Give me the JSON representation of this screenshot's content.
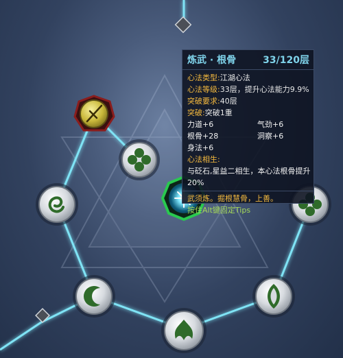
{
  "tooltip": {
    "title": "炼武 · 根骨",
    "level_text": "33/120层",
    "type_label": "心法类型:",
    "type_value": "江湖心法",
    "level_label": "心法等级:",
    "level_value": "33层，提升心法能力9.9%",
    "breakthrough_req_label": "突破要求:",
    "breakthrough_req_value": "40层",
    "breakthrough_label": "突破:",
    "breakthrough_value": "突破1重",
    "stats": [
      {
        "left": "力道+6",
        "right": "气劲+6"
      },
      {
        "left": "根骨+28",
        "right": "洞察+6"
      },
      {
        "left": "身法+6",
        "right": ""
      }
    ],
    "synergy_label": "心法相生:",
    "synergy_text_line1": "与砭石,星益二相生，本心法根骨提升",
    "synergy_text_line2": "20%",
    "quote": "武须炼。掘根慧骨，上善。",
    "hint": "按住Alt键固定Tips"
  },
  "nodes": [
    {
      "id": "top-left-emblem",
      "icon": "crossed-blade-icon",
      "style": "gold"
    },
    {
      "id": "clover-upper",
      "icon": "clover-icon",
      "style": "silver"
    },
    {
      "id": "spiral-left",
      "icon": "spiral-icon",
      "style": "silver"
    },
    {
      "id": "center-selected",
      "icon": "star-burst-icon",
      "style": "selected"
    },
    {
      "id": "clover-right",
      "icon": "clover-icon",
      "style": "silver"
    },
    {
      "id": "crescent-lower-left",
      "icon": "crescent-icon",
      "style": "silver"
    },
    {
      "id": "leaf-lower-right",
      "icon": "leaf-icon",
      "style": "silver"
    },
    {
      "id": "flame-bottom",
      "icon": "flame-icon",
      "style": "silver"
    }
  ],
  "colors": {
    "link_glow": "#7fe3f5",
    "node_green": "#2f6b2a",
    "selected_ring": "#29c94f",
    "gold": "#d4c24a",
    "tooltip_title": "#7fd3ea",
    "tooltip_label": "#f4b93e",
    "tooltip_hint": "#a6d95a"
  }
}
